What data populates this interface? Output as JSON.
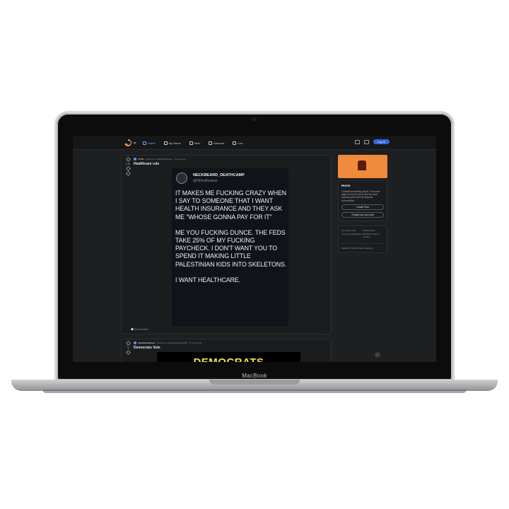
{
  "device": {
    "brand": "MacBook"
  },
  "nav": {
    "items": [
      {
        "label": "Home"
      },
      {
        "label": "My Home"
      },
      {
        "label": "New"
      },
      {
        "label": "Discover"
      },
      {
        "label": "Live"
      }
    ],
    "login_label": "Log In",
    "accent": "#3a63d8"
  },
  "posts": [
    {
      "community": "c/YTA",
      "posted_by": "Posted by u/rattleRattlesnger · 9 hours ago",
      "score": "1.3K",
      "title": "Healthcare rule",
      "tweet": {
        "name": "NECKBEARD_DEATHCAMP",
        "handle": "@NDeathcamp",
        "para1": "IT MAKES ME FUCKING CRAZY WHEN I SAY TO SOMEONE THAT I WANT HEALTH INSURANCE AND THEY ASK ME \"WHOSE GONNA PAY FOR IT\"",
        "para2": "ME YOU FUCKING DUNCE. THE FEDS TAKE 25% OF MY FUCKING PAYCHECK. I DON'T WANT YOU TO SPEND IT MAKING LITTLE PALESTINIAN KIDS INTO SKELETONS.",
        "para3": "I WANT HEALTHCARE."
      },
      "comments": "98 comments",
      "more": "..."
    },
    {
      "community": "c/politicalmemes",
      "posted_by": "Posted by u/humanwaterfaced84 · 17 hours ago",
      "score": "74",
      "title": "Democrats Vote",
      "image_text": "DEMOCRATS"
    }
  ],
  "sidebar": {
    "heading": "Home",
    "description": "Clubs98 connecting people. The home page is here for you to see the most popular posts from the featured communities.",
    "create_post": "Create Post",
    "create_club": "Create your own club",
    "links": [
      "User Agreement",
      "Privacy Policy",
      "Community Guidelines",
      "Moderator Code of Conduct"
    ],
    "copyright": "Clubs98 © 2024. All rights reserved.",
    "banner_color": "#f08a3c"
  },
  "scroll_top": "↑"
}
